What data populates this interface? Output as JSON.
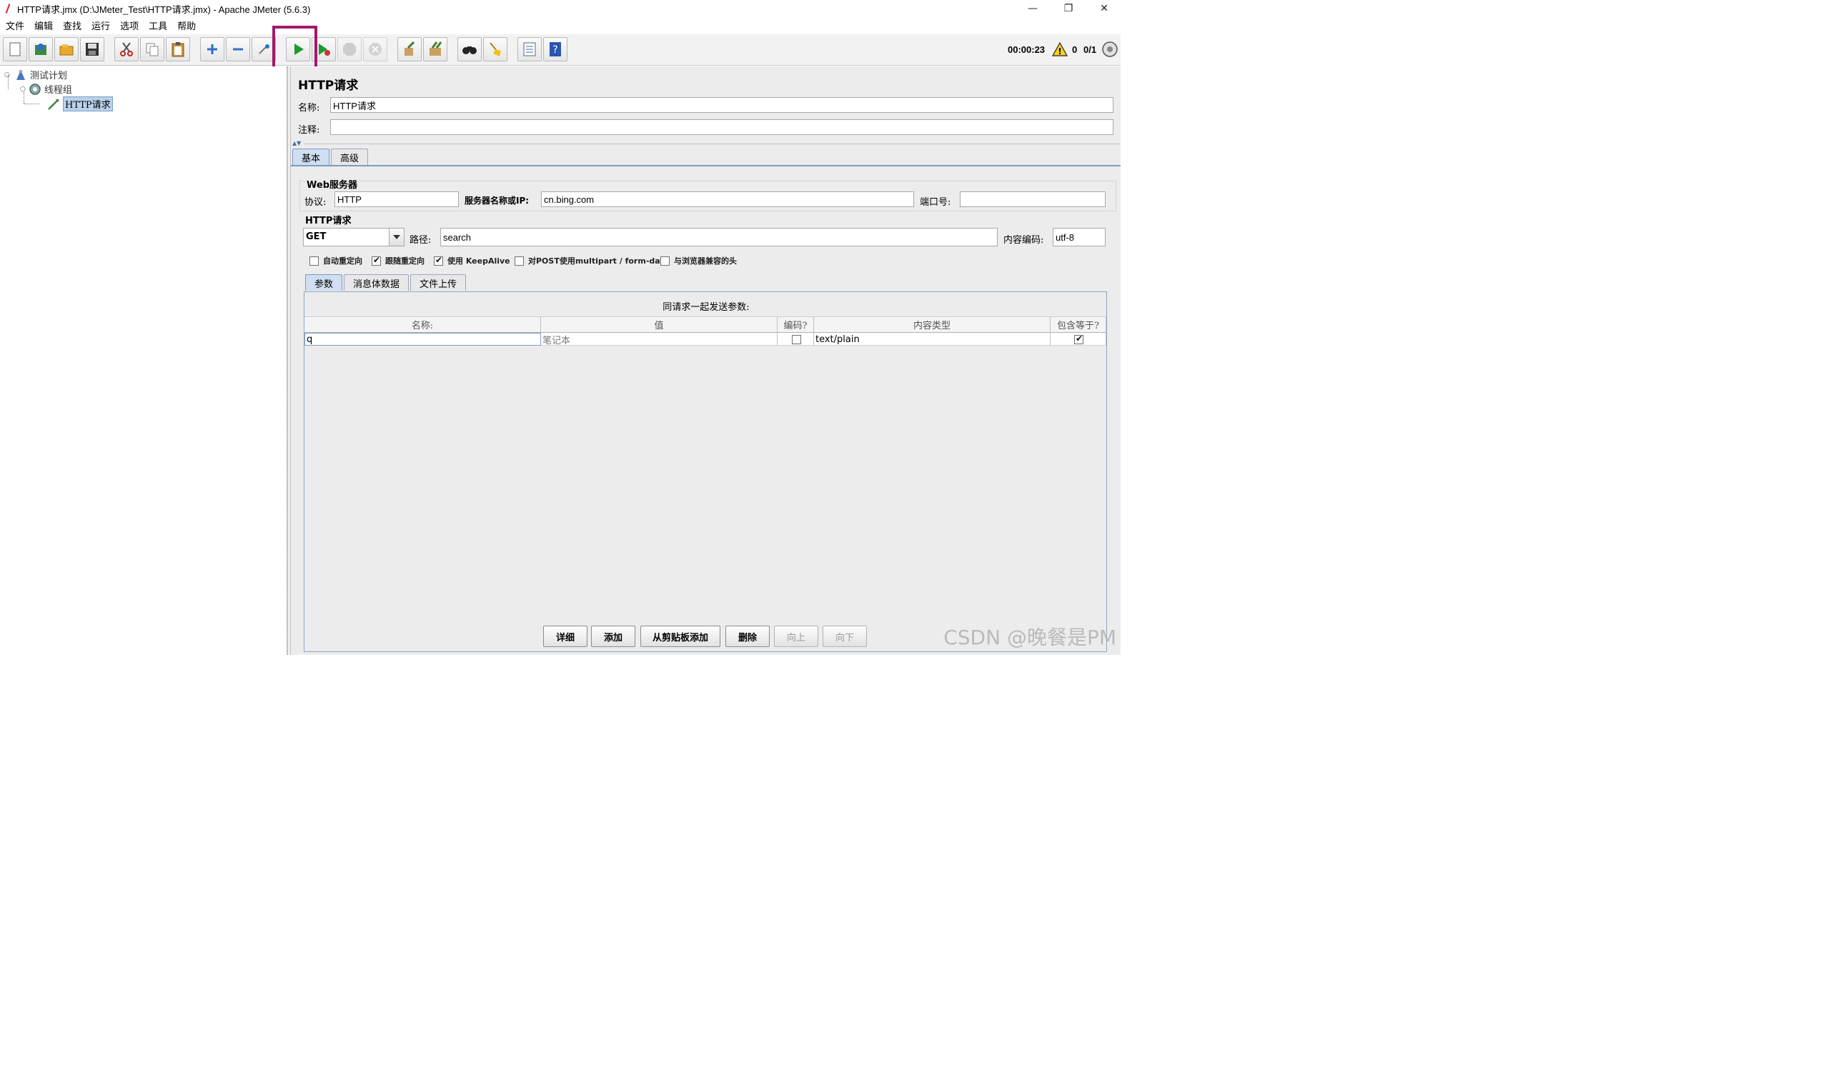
{
  "window": {
    "title": "HTTP请求.jmx (D:\\JMeter_Test\\HTTP请求.jmx) - Apache JMeter (5.6.3)",
    "minimize_glyph": "—",
    "restore_glyph": "❐",
    "close_glyph": "✕"
  },
  "menu": [
    "文件",
    "编辑",
    "查找",
    "运行",
    "选项",
    "工具",
    "帮助"
  ],
  "toolbar": {
    "buttons": [
      "new-icon",
      "templates-icon",
      "open-icon",
      "save-icon",
      "cut-icon",
      "copy-icon",
      "paste-icon",
      "expand-icon",
      "collapse-icon",
      "toggle-icon",
      "start-icon",
      "start-no-pause-icon",
      "stop-icon",
      "shutdown-icon",
      "clear-icon",
      "clear-all-icon",
      "search-icon",
      "reset-search-icon",
      "function-helper-icon",
      "help-icon"
    ],
    "elapsed_time": "00:00:23",
    "warning_count": "0",
    "threads": "0/1",
    "highlight_color": "#a3186b"
  },
  "tree": {
    "nodes": [
      {
        "label": "测试计划",
        "icon": "test-plan-icon"
      },
      {
        "label": "线程组",
        "icon": "thread-group-icon"
      },
      {
        "label": "HTTP请求",
        "icon": "http-sampler-icon",
        "selected": true
      }
    ]
  },
  "panel": {
    "title": "HTTP请求",
    "name_label": "名称:",
    "name_value": "HTTP请求",
    "comment_label": "注释:",
    "comment_value": "",
    "tabs": [
      "基本",
      "高级"
    ],
    "web_server": {
      "title_prefix": "Web",
      "title_suffix": "服务器",
      "protocol_label": "协议:",
      "protocol_value": "HTTP",
      "server_label": "服务器名称或IP:",
      "server_value": "cn.bing.com",
      "port_label": "端口号:",
      "port_value": ""
    },
    "http_request": {
      "title_prefix": "HTTP",
      "title_suffix": "请求",
      "method": "GET",
      "path_label": "路径:",
      "path_value": "search",
      "encoding_label": "内容编码:",
      "encoding_value": "utf-8"
    },
    "options": [
      {
        "label": "自动重定向",
        "checked": false
      },
      {
        "label": "跟随重定向",
        "checked": true
      },
      {
        "label": "使用 KeepAlive",
        "checked": true
      },
      {
        "label": "对POST使用multipart / form-data",
        "checked": false
      },
      {
        "label": "与浏览器兼容的头",
        "checked": false
      }
    ],
    "sub_tabs": [
      "参数",
      "消息体数据",
      "文件上传"
    ],
    "params": {
      "caption": "同请求一起发送参数:",
      "columns": [
        "名称:",
        "值",
        "编码?",
        "内容类型",
        "包含等于?"
      ],
      "rows": [
        {
          "name": "q",
          "value": "笔记本",
          "encode": false,
          "content_type": "text/plain",
          "include_equals": true
        }
      ]
    },
    "buttons": [
      {
        "label": "详细",
        "enabled": true
      },
      {
        "label": "添加",
        "enabled": true
      },
      {
        "label": "从剪贴板添加",
        "enabled": true
      },
      {
        "label": "删除",
        "enabled": true
      },
      {
        "label": "向上",
        "enabled": false
      },
      {
        "label": "向下",
        "enabled": false
      }
    ]
  },
  "watermark": "CSDN @晚餐是PM"
}
